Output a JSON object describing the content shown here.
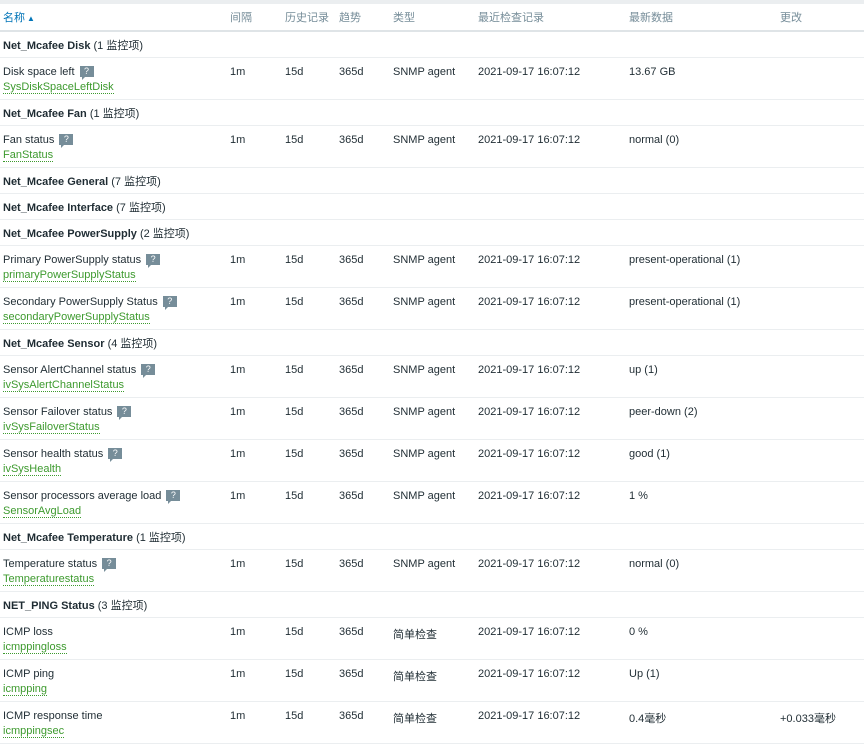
{
  "columns": {
    "name": "名称",
    "interval": "间隔",
    "history": "历史记录",
    "trends": "趋势",
    "type": "类型",
    "last_check": "最近检查记录",
    "last_value": "最新数据",
    "change": "更改"
  },
  "groups": [
    {
      "name": "Net_Mcafee Disk",
      "count": "(1 监控项)",
      "items": [
        {
          "name": "Disk space left",
          "help": true,
          "key": "SysDiskSpaceLeftDisk",
          "interval": "1m",
          "history": "15d",
          "trends": "365d",
          "type": "SNMP agent",
          "last_check": "2021-09-17 16:07:12",
          "last_value": "13.67 GB",
          "change": ""
        }
      ]
    },
    {
      "name": "Net_Mcafee Fan",
      "count": "(1 监控项)",
      "items": [
        {
          "name": "Fan status",
          "help": true,
          "key": "FanStatus",
          "interval": "1m",
          "history": "15d",
          "trends": "365d",
          "type": "SNMP agent",
          "last_check": "2021-09-17 16:07:12",
          "last_value": "normal (0)",
          "change": ""
        }
      ]
    },
    {
      "name": "Net_Mcafee General",
      "count": "(7 监控项)",
      "items": []
    },
    {
      "name": "Net_Mcafee Interface",
      "count": "(7 监控项)",
      "items": []
    },
    {
      "name": "Net_Mcafee PowerSupply",
      "count": "(2 监控项)",
      "items": [
        {
          "name": "Primary PowerSupply status",
          "help": true,
          "key": "primaryPowerSupplyStatus",
          "interval": "1m",
          "history": "15d",
          "trends": "365d",
          "type": "SNMP agent",
          "last_check": "2021-09-17 16:07:12",
          "last_value": "present-operational (1)",
          "change": ""
        },
        {
          "name": "Secondary PowerSupply Status",
          "help": true,
          "key": "secondaryPowerSupplyStatus",
          "interval": "1m",
          "history": "15d",
          "trends": "365d",
          "type": "SNMP agent",
          "last_check": "2021-09-17 16:07:12",
          "last_value": "present-operational (1)",
          "change": ""
        }
      ]
    },
    {
      "name": "Net_Mcafee Sensor",
      "count": "(4 监控项)",
      "items": [
        {
          "name": "Sensor AlertChannel status",
          "help": true,
          "key": "ivSysAlertChannelStatus",
          "interval": "1m",
          "history": "15d",
          "trends": "365d",
          "type": "SNMP agent",
          "last_check": "2021-09-17 16:07:12",
          "last_value": "up (1)",
          "change": ""
        },
        {
          "name": "Sensor Failover status",
          "help": true,
          "key": "ivSysFailoverStatus",
          "interval": "1m",
          "history": "15d",
          "trends": "365d",
          "type": "SNMP agent",
          "last_check": "2021-09-17 16:07:12",
          "last_value": "peer-down (2)",
          "change": ""
        },
        {
          "name": "Sensor health status",
          "help": true,
          "key": "ivSysHealth",
          "interval": "1m",
          "history": "15d",
          "trends": "365d",
          "type": "SNMP agent",
          "last_check": "2021-09-17 16:07:12",
          "last_value": "good (1)",
          "change": ""
        },
        {
          "name": "Sensor processors average load",
          "help": true,
          "key": "SensorAvgLoad",
          "interval": "1m",
          "history": "15d",
          "trends": "365d",
          "type": "SNMP agent",
          "last_check": "2021-09-17 16:07:12",
          "last_value": "1 %",
          "change": ""
        }
      ]
    },
    {
      "name": "Net_Mcafee Temperature",
      "count": "(1 监控项)",
      "items": [
        {
          "name": "Temperature status",
          "help": true,
          "key": "Temperaturestatus",
          "interval": "1m",
          "history": "15d",
          "trends": "365d",
          "type": "SNMP agent",
          "last_check": "2021-09-17 16:07:12",
          "last_value": "normal (0)",
          "change": ""
        }
      ]
    },
    {
      "name": "NET_PING Status",
      "count": "(3 监控项)",
      "items": [
        {
          "name": "ICMP loss",
          "help": false,
          "key": "icmppingloss",
          "interval": "1m",
          "history": "15d",
          "trends": "365d",
          "type": "简单检查",
          "last_check": "2021-09-17 16:07:12",
          "last_value": "0 %",
          "change": ""
        },
        {
          "name": "ICMP ping",
          "help": false,
          "key": "icmpping",
          "interval": "1m",
          "history": "15d",
          "trends": "365d",
          "type": "简单检查",
          "last_check": "2021-09-17 16:07:12",
          "last_value": "Up (1)",
          "change": ""
        },
        {
          "name": "ICMP response time",
          "help": false,
          "key": "icmppingsec",
          "interval": "1m",
          "history": "15d",
          "trends": "365d",
          "type": "简单检查",
          "last_check": "2021-09-17 16:07:12",
          "last_value": "0.4毫秒",
          "change": "+0.033毫秒"
        }
      ]
    }
  ]
}
